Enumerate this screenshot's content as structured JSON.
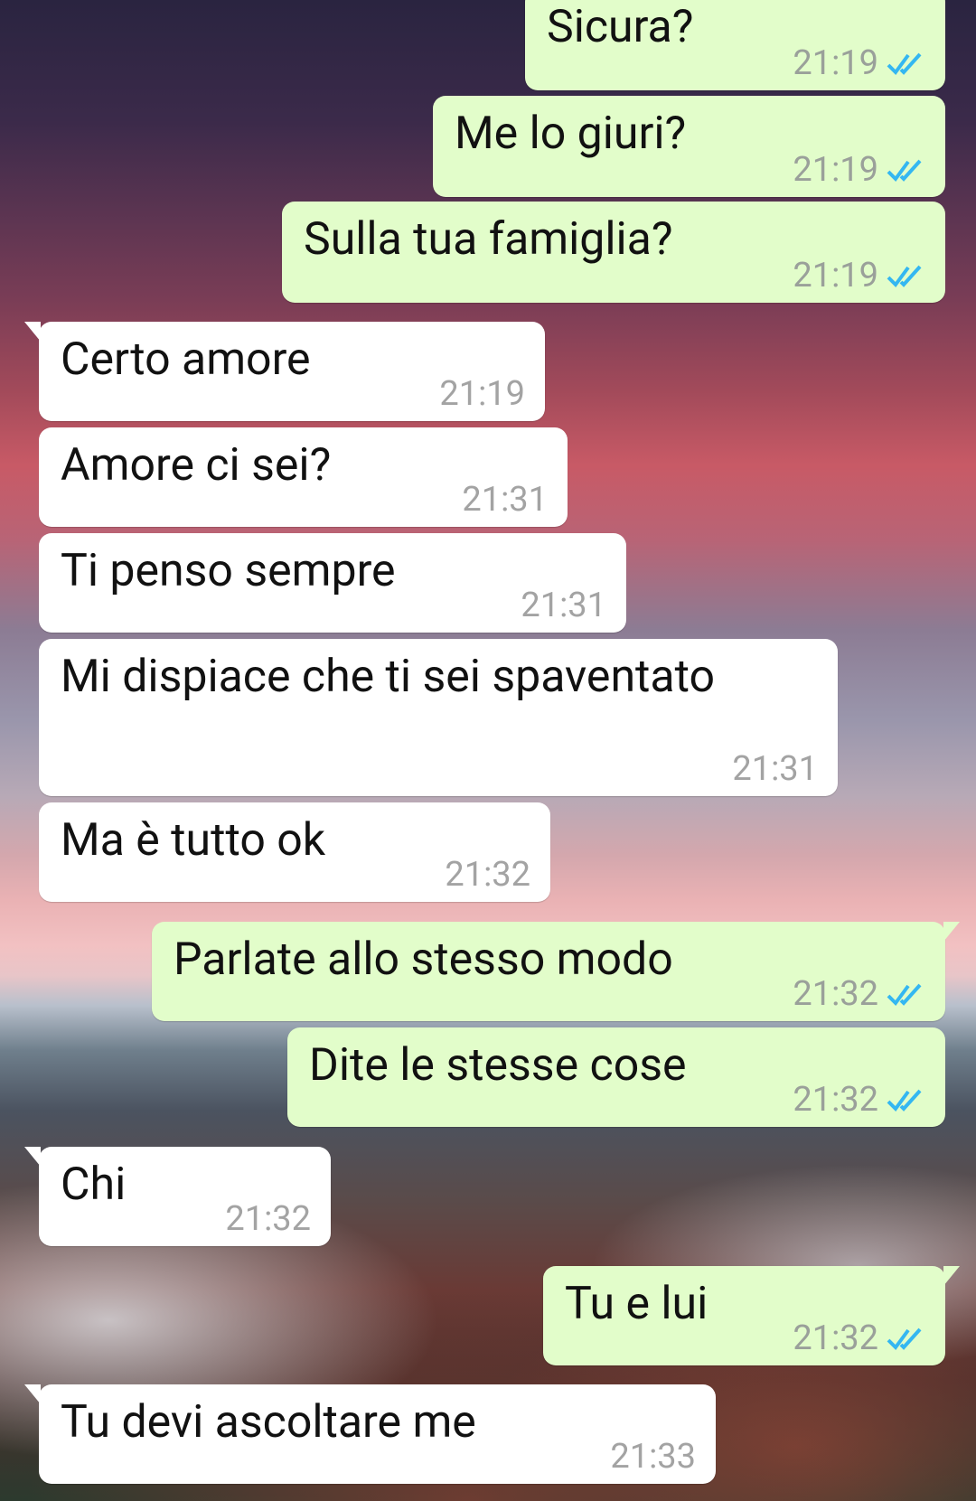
{
  "messages": [
    {
      "dir": "out",
      "text": "Sicura?",
      "time": "21:19",
      "status_icon": "double-check-read-icon"
    },
    {
      "dir": "out",
      "text": "Me lo giuri?",
      "time": "21:19",
      "status_icon": "double-check-read-icon"
    },
    {
      "dir": "out",
      "text": "Sulla tua famiglia?",
      "time": "21:19",
      "status_icon": "double-check-read-icon"
    },
    {
      "dir": "in",
      "text": "Certo amore",
      "time": "21:19"
    },
    {
      "dir": "in",
      "text": "Amore ci sei?",
      "time": "21:31"
    },
    {
      "dir": "in",
      "text": "Ti penso sempre",
      "time": "21:31"
    },
    {
      "dir": "in",
      "text": "Mi dispiace che ti sei spaventato",
      "time": "21:31"
    },
    {
      "dir": "in",
      "text": "Ma è tutto ok",
      "time": "21:32"
    },
    {
      "dir": "out",
      "text": "Parlate allo stesso modo",
      "time": "21:32",
      "status_icon": "double-check-read-icon"
    },
    {
      "dir": "out",
      "text": "Dite le stesse cose",
      "time": "21:32",
      "status_icon": "double-check-read-icon"
    },
    {
      "dir": "in",
      "text": "Chi",
      "time": "21:32"
    },
    {
      "dir": "out",
      "text": "Tu e lui",
      "time": "21:32",
      "status_icon": "double-check-read-icon"
    },
    {
      "dir": "in",
      "text": "Tu devi ascoltare me",
      "time": "21:33"
    }
  ],
  "colors": {
    "outgoing_bubble": "#e2fdca",
    "incoming_bubble": "#ffffff",
    "read_ticks": "#34b7f1",
    "timestamp": "#9aa09a"
  }
}
